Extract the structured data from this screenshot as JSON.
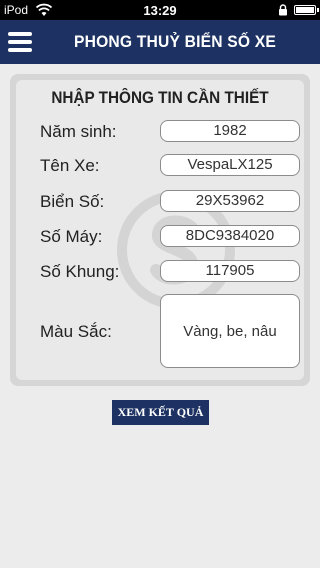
{
  "status": {
    "carrier": "iPod",
    "time": "13:29"
  },
  "header": {
    "title": "PHONG THUỶ BIỂN SỐ XE"
  },
  "form": {
    "title": "NHẬP THÔNG TIN CẦN THIẾT",
    "fields": [
      {
        "label": "Năm sinh:",
        "value": "1982"
      },
      {
        "label": "Tên Xe:",
        "value": "VespaLX125"
      },
      {
        "label": "Biển Số:",
        "value": "29X53962"
      },
      {
        "label": "Số Máy:",
        "value": "8DC9384020"
      },
      {
        "label": "Số Khung:",
        "value": "117905"
      },
      {
        "label": "Màu Sắc:",
        "value": "Vàng, be, nâu"
      }
    ]
  },
  "actions": {
    "submit_label": "XEM KẾT QUẢ"
  },
  "colors": {
    "navbar": "#1d3262",
    "background": "#ececec",
    "card": "#d6d6d6"
  },
  "icons": [
    "wifi-icon",
    "lock-icon",
    "battery-icon",
    "menu-icon",
    "watermark-logo"
  ]
}
